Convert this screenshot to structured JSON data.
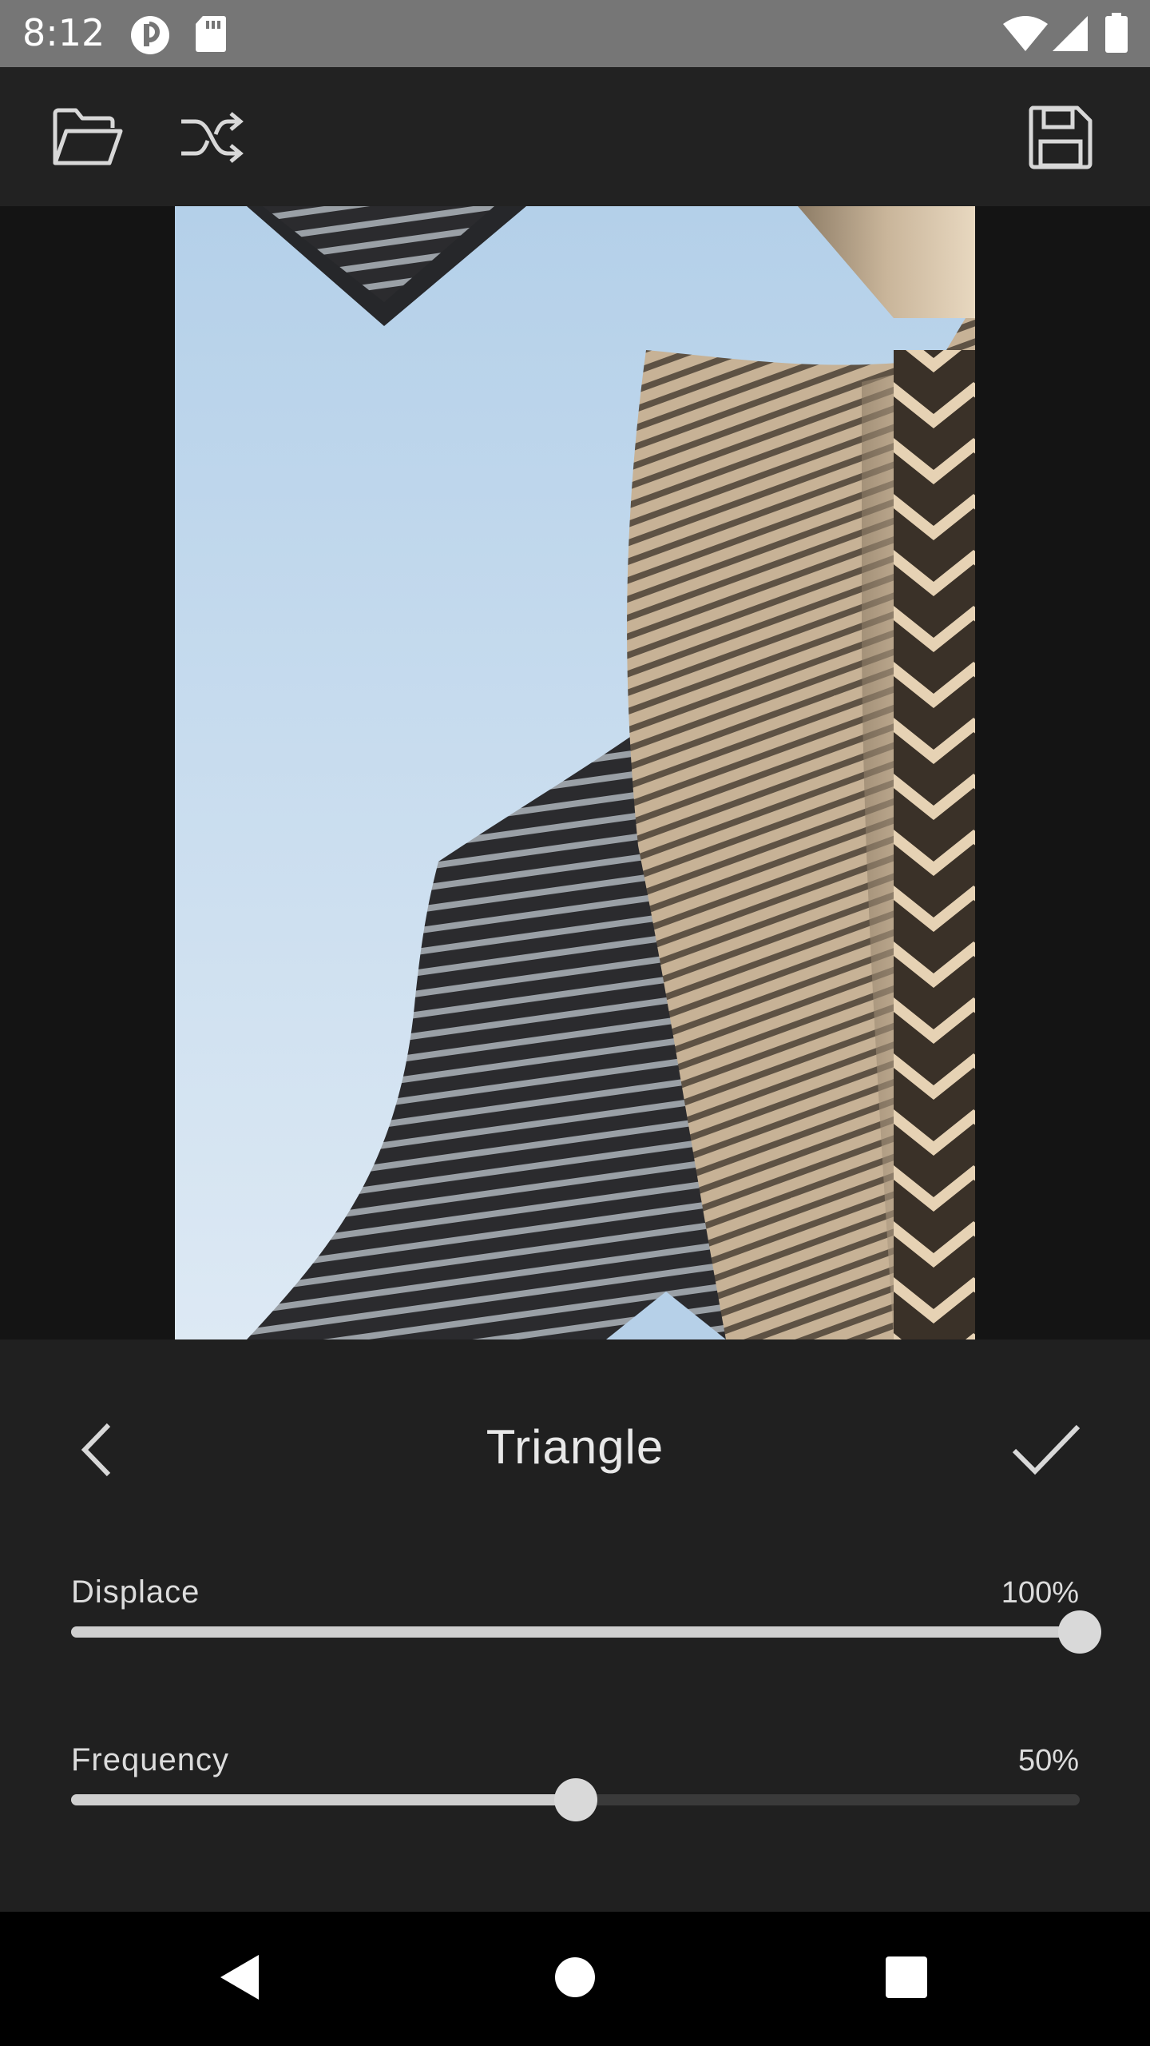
{
  "status_bar": {
    "time": "8:12",
    "icons": [
      "app-notification-icon",
      "sd-card-icon",
      "wifi-icon",
      "cellular-signal-icon",
      "battery-icon"
    ]
  },
  "toolbar": {
    "icons": [
      "folder-open-icon",
      "shuffle-icon",
      "save-icon"
    ]
  },
  "editor": {
    "effect_title": "Triangle",
    "sliders": [
      {
        "label": "Displace",
        "value_text": "100%",
        "value": 1.0
      },
      {
        "label": "Frequency",
        "value_text": "50%",
        "value": 0.5
      }
    ]
  },
  "nav_bar": {
    "icons": [
      "back-triangle-icon",
      "home-circle-icon",
      "recents-square-icon"
    ]
  },
  "colors": {
    "status_bar": "#767676",
    "toolbar": "#222222",
    "panel": "#202020",
    "track": "#3a3a3a",
    "fill": "#cfcfcf"
  }
}
